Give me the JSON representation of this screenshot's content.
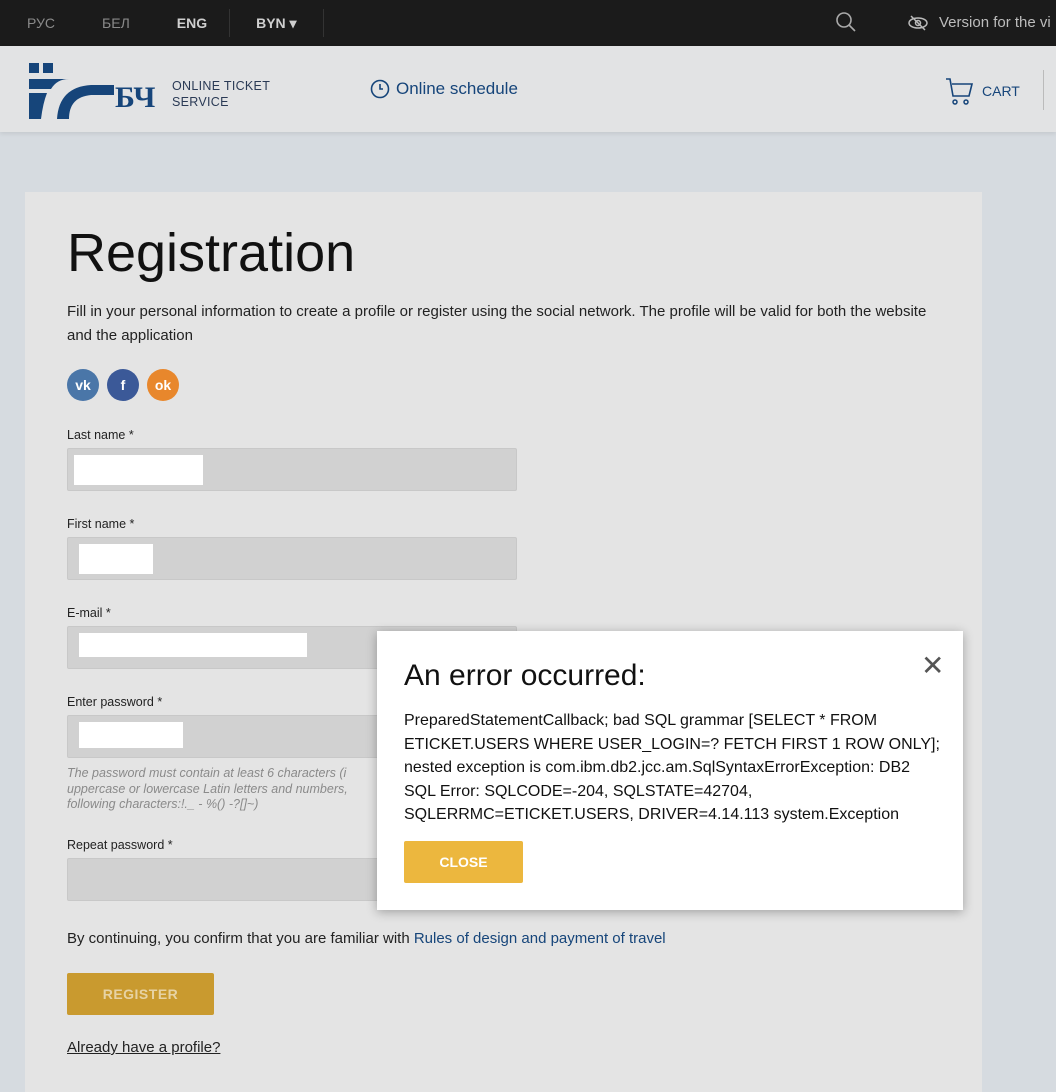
{
  "topbar": {
    "languages": [
      "РУС",
      "БЕЛ",
      "ENG"
    ],
    "active_language": "ENG",
    "currency": "BYN",
    "accessibility": "Version for the vi"
  },
  "header": {
    "logo_text_line1": "ONLINE TICKET",
    "logo_text_line2": "SERVICE",
    "logo_letters": "БЧ",
    "schedule": "Online schedule",
    "cart": "CART"
  },
  "form": {
    "title": "Registration",
    "intro": "Fill in your personal information to create a profile or register using the social network. The profile will be valid for both the website and the application",
    "social": [
      "vk",
      "f",
      "ok"
    ],
    "last_name_label": "Last name *",
    "first_name_label": "First name *",
    "email_label": "E-mail *",
    "password_label": "Enter password *",
    "password_hint_lines": [
      "The password must contain at least 6 characters (i",
      "uppercase or lowercase Latin letters and numbers,",
      "following characters:!._ - %() -?[]~)"
    ],
    "repeat_label": "Repeat password *",
    "confirm_text": "By continuing, you confirm that you are familiar with ",
    "rules_link": "Rules of design and payment of travel",
    "register": "REGISTER",
    "already": "Already have a profile?"
  },
  "modal": {
    "title": "An error occurred:",
    "message": "PreparedStatementCallback; bad SQL grammar [SELECT * FROM ETICKET.USERS WHERE USER_LOGIN=? FETCH FIRST 1 ROW ONLY]; nested exception is com.ibm.db2.jcc.am.SqlSyntaxErrorException: DB2 SQL Error: SQLCODE=-204, SQLSTATE=42704, SQLERRMC=ETICKET.USERS, DRIVER=4.14.113 system.Exception",
    "close": "CLOSE"
  }
}
